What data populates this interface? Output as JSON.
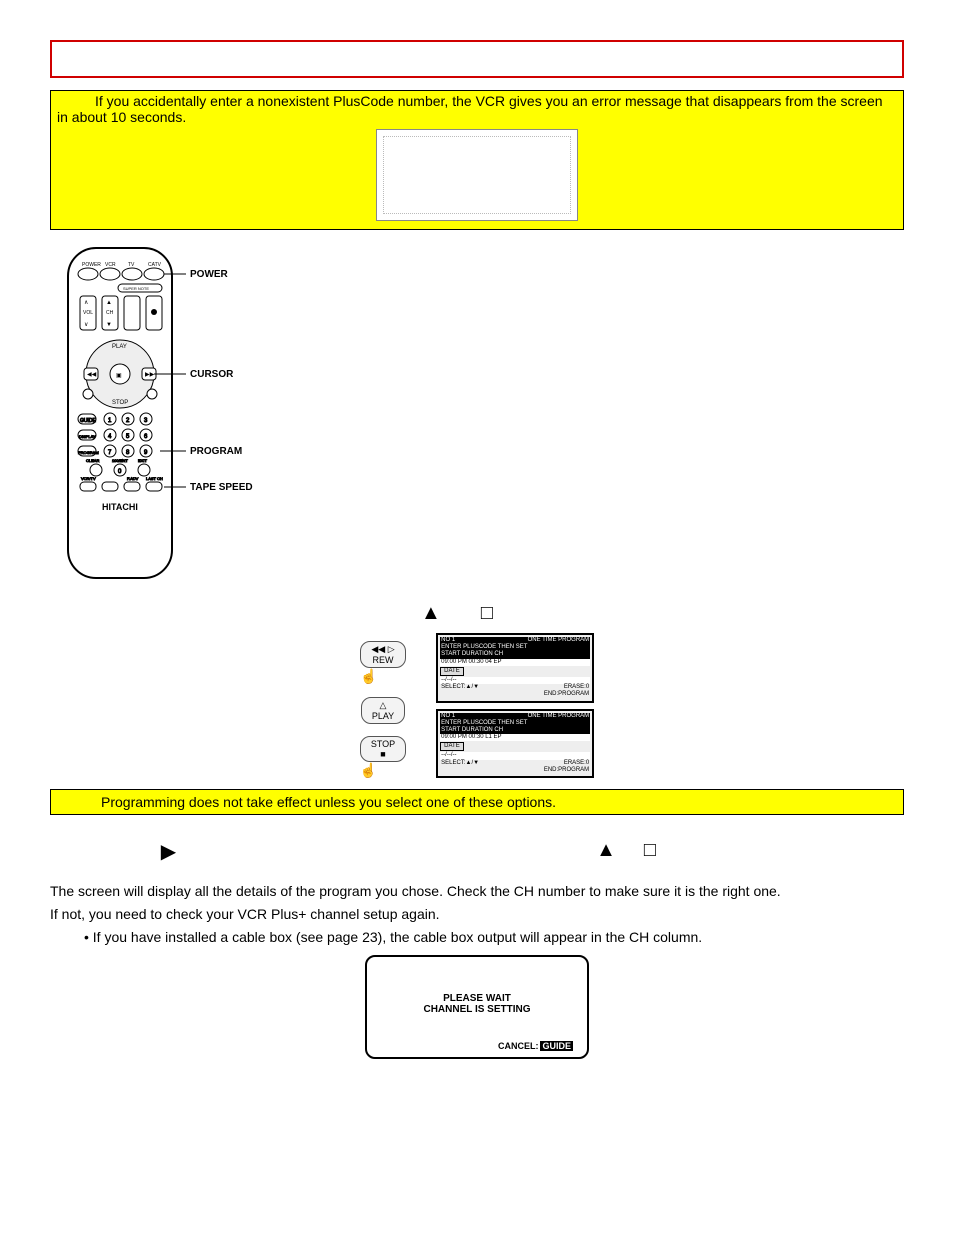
{
  "warning1": "If you accidentally enter a nonexistent PlusCode number, the VCR gives you an error message that disappears from the screen in about 10 seconds.",
  "remote_labels": {
    "power": "POWER",
    "cursor": "CURSOR",
    "program": "PROGRAM",
    "tape_speed": "TAPE SPEED",
    "brand": "HITACHI"
  },
  "mini_buttons": {
    "rew": "REW",
    "play": "PLAY",
    "stop": "STOP"
  },
  "osd": {
    "no": "NO 1",
    "mode": "ONE TIME PROGRAM",
    "header2": "ENTER PLUSCODE THEN SET",
    "cols": "START     DURATION   CH",
    "vals_a": "09:00 PM   00:30      04   EP",
    "vals_b": "09:00 PM   00:30      L1   EP",
    "date_label": "DATE",
    "date_val": "--/--/--",
    "select": "SELECT:▲/▼",
    "erase": "ERASE:0",
    "end": "END:PROGRAM"
  },
  "warning2": "Programming does not take effect unless you select one of these options.",
  "body": {
    "p1": "The screen will display all the details of the program you chose. Check the CH number to make sure it is the right one.",
    "p2": "If not, you need to check your VCR Plus+ channel setup again.",
    "b1": "If you have installed a cable box (see page 23), the cable box output will appear in the CH column."
  },
  "screen": {
    "l1": "PLEASE WAIT",
    "l2": "CHANNEL IS SETTING",
    "cancel": "CANCEL:",
    "guide": "GUIDE"
  },
  "glyphs": {
    "up": "▲",
    "stop": "□",
    "play": "▶"
  }
}
